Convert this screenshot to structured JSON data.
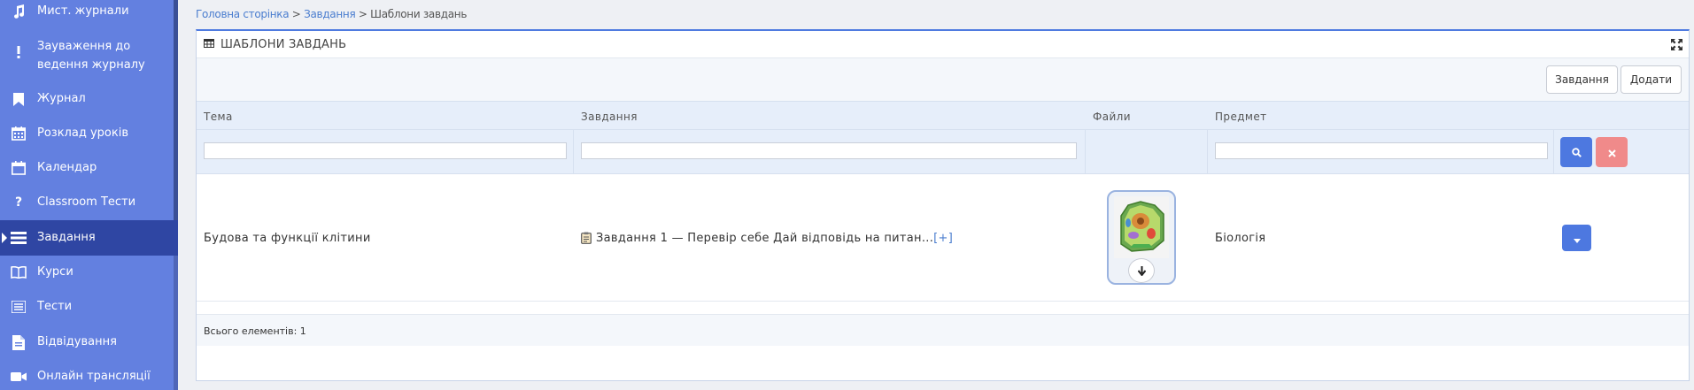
{
  "sidebar": {
    "items": [
      {
        "label": "Мист. журнали",
        "icon": "music-note-icon"
      },
      {
        "label": "Зауваження до",
        "label2": "ведення журналу",
        "icon": "exclamation-icon"
      },
      {
        "label": "Журнал",
        "icon": "bookmark-icon"
      },
      {
        "label": "Розклад уроків",
        "icon": "calendar-grid-icon"
      },
      {
        "label": "Календар",
        "icon": "calendar-icon"
      },
      {
        "label": "Classroom Тести",
        "icon": "question-icon"
      },
      {
        "label": "Завдання",
        "icon": "tasks-icon"
      },
      {
        "label": "Курси",
        "icon": "book-open-icon"
      },
      {
        "label": "Тести",
        "icon": "list-icon"
      },
      {
        "label": "Відвідування",
        "icon": "document-icon"
      },
      {
        "label": "Онлайн трансляції",
        "icon": "video-camera-icon"
      }
    ],
    "active_index": 6
  },
  "breadcrumb": {
    "home": "Головна сторінка",
    "sep1": " > ",
    "tasks": "Завдання",
    "sep2": " > ",
    "current": "Шаблони завдань"
  },
  "panel": {
    "title": "ШАБЛОНИ ЗАВДАНЬ",
    "title_icon": "table-icon",
    "expand_icon": "expand-icon"
  },
  "toolbar": {
    "tasks_label": "Завдання",
    "add_label": "Додати"
  },
  "grid": {
    "columns": [
      "Тема",
      "Завдання",
      "Файли",
      "Предмет"
    ],
    "filters": {
      "topic": "",
      "task": "",
      "subject": ""
    },
    "rows": [
      {
        "topic": "Будова та функції клітини",
        "task_text": "Завдання 1 — Перевір себе Дай відповідь на питан...",
        "task_more": "[+]",
        "file_icon": "plant-cell-thumbnail",
        "subject": "Біологія"
      }
    ]
  },
  "footer": {
    "total": "Всього елементів: 1"
  },
  "colors": {
    "sidebar": "#6380e0",
    "sidebar_active": "#2f46a3",
    "accent": "#4d78e0",
    "clear": "#f08a8a"
  }
}
